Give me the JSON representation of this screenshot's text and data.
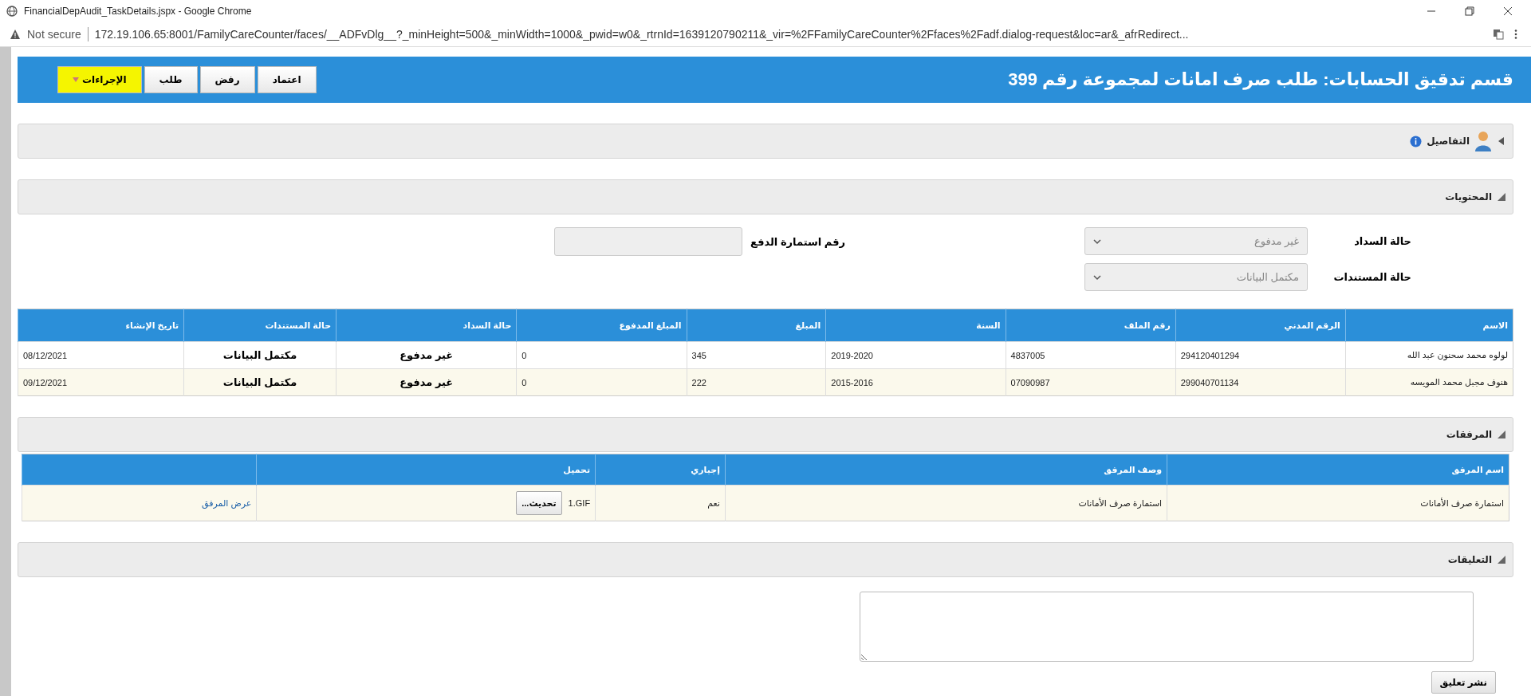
{
  "window": {
    "title": "FinancialDepAudit_TaskDetails.jspx - Google Chrome"
  },
  "address_bar": {
    "security": "Not secure",
    "url": "172.19.106.65:8001/FamilyCareCounter/faces/__ADFvDlg__?_minHeight=500&_minWidth=1000&_pwid=w0&_rtrnId=1639120790211&_vir=%2FFamilyCareCounter%2Ffaces%2Fadf.dialog-request&loc=ar&_afrRedirect..."
  },
  "header": {
    "title": "قسم تدقيق الحسابات: طلب صرف امانات لمجموعة رقم 399",
    "buttons": [
      {
        "label": "اعتماد",
        "kind": "button",
        "highlighted": false
      },
      {
        "label": "رفض",
        "kind": "button",
        "highlighted": false
      },
      {
        "label": "طلب",
        "kind": "button",
        "highlighted": false
      },
      {
        "label": "الإجراءات",
        "kind": "menu",
        "highlighted": true
      }
    ]
  },
  "details": {
    "title": "التفاصيل",
    "expanded": false
  },
  "contents": {
    "title": "المحتويات",
    "expanded": true,
    "fields": [
      {
        "label": "حالة السداد",
        "kind": "select",
        "value": "غير مدفوع",
        "disabled": true
      },
      {
        "label": "حالة المستندات",
        "kind": "select",
        "value": "مكتمل البيانات",
        "disabled": true
      },
      {
        "label": "رقم استمارة الدفع",
        "kind": "text",
        "disabled": true
      }
    ],
    "table": {
      "columns": [
        "الاسم",
        "الرقم المدني",
        "رقم الملف",
        "السنة",
        "المبلغ",
        "المبلغ المدفوع",
        "حالة السداد",
        "حالة المستندات",
        "تاريخ الإنشاء"
      ],
      "rows": [
        [
          "لولوه محمد سحنون عبد الله",
          "294120401294",
          "4837005",
          "2019-2020",
          "345",
          "0",
          "غير مدفوع",
          "مكتمل البيانات",
          "08/12/2021"
        ],
        [
          "هنوف مجبل محمد المويسه",
          "299040701134",
          "07090987",
          "2015-2016",
          "222",
          "0",
          "غير مدفوع",
          "مكتمل البيانات",
          "09/12/2021"
        ]
      ]
    }
  },
  "attachments": {
    "title": "المرفقات",
    "expanded": true,
    "columns": [
      "اسم المرفق",
      "وصف المرفق",
      "إجباري",
      "تحميل"
    ],
    "rows": [
      {
        "name": "استمارة صرف الأمانات",
        "description": "استمارة صرف الأمانات",
        "mandatory": "نعم",
        "file": "1.GIF",
        "upload_button": "تحديث...",
        "link": "عرض المرفق"
      }
    ]
  },
  "comments": {
    "title": "التعليقات",
    "expanded": true,
    "button": "نشر تعليق"
  }
}
